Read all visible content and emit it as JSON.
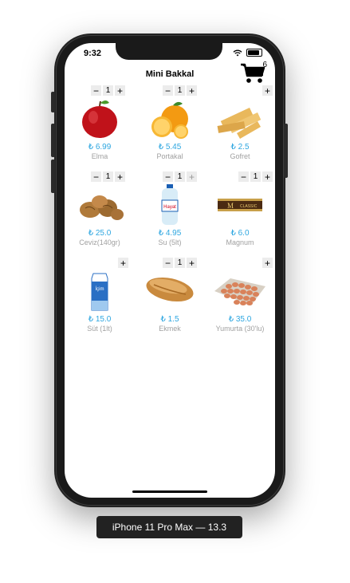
{
  "device": {
    "label": "iPhone 11 Pro Max — 13.3"
  },
  "status_bar": {
    "time": "9:32"
  },
  "nav": {
    "title": "Mini Bakkal",
    "cart_count": "6"
  },
  "products": [
    {
      "name": "Elma",
      "price": "₺ 6.99",
      "qty": "1",
      "has_qty": true
    },
    {
      "name": "Portakal",
      "price": "₺ 5.45",
      "qty": "1",
      "has_qty": true
    },
    {
      "name": "Gofret",
      "price": "₺ 2.5",
      "qty": "",
      "has_qty": false
    },
    {
      "name": "Ceviz(140gr)",
      "price": "₺ 25.0",
      "qty": "1",
      "has_qty": true
    },
    {
      "name": "Su (5lt)",
      "price": "₺ 4.95",
      "qty": "1",
      "has_qty": true
    },
    {
      "name": "Magnum",
      "price": "₺ 6.0",
      "qty": "1",
      "has_qty": true
    },
    {
      "name": "Süt (1lt)",
      "price": "₺ 15.0",
      "qty": "",
      "has_qty": false
    },
    {
      "name": "Ekmek",
      "price": "₺ 1.5",
      "qty": "1",
      "has_qty": true
    },
    {
      "name": "Yumurta (30'lu)",
      "price": "₺ 35.0",
      "qty": "",
      "has_qty": false
    }
  ]
}
